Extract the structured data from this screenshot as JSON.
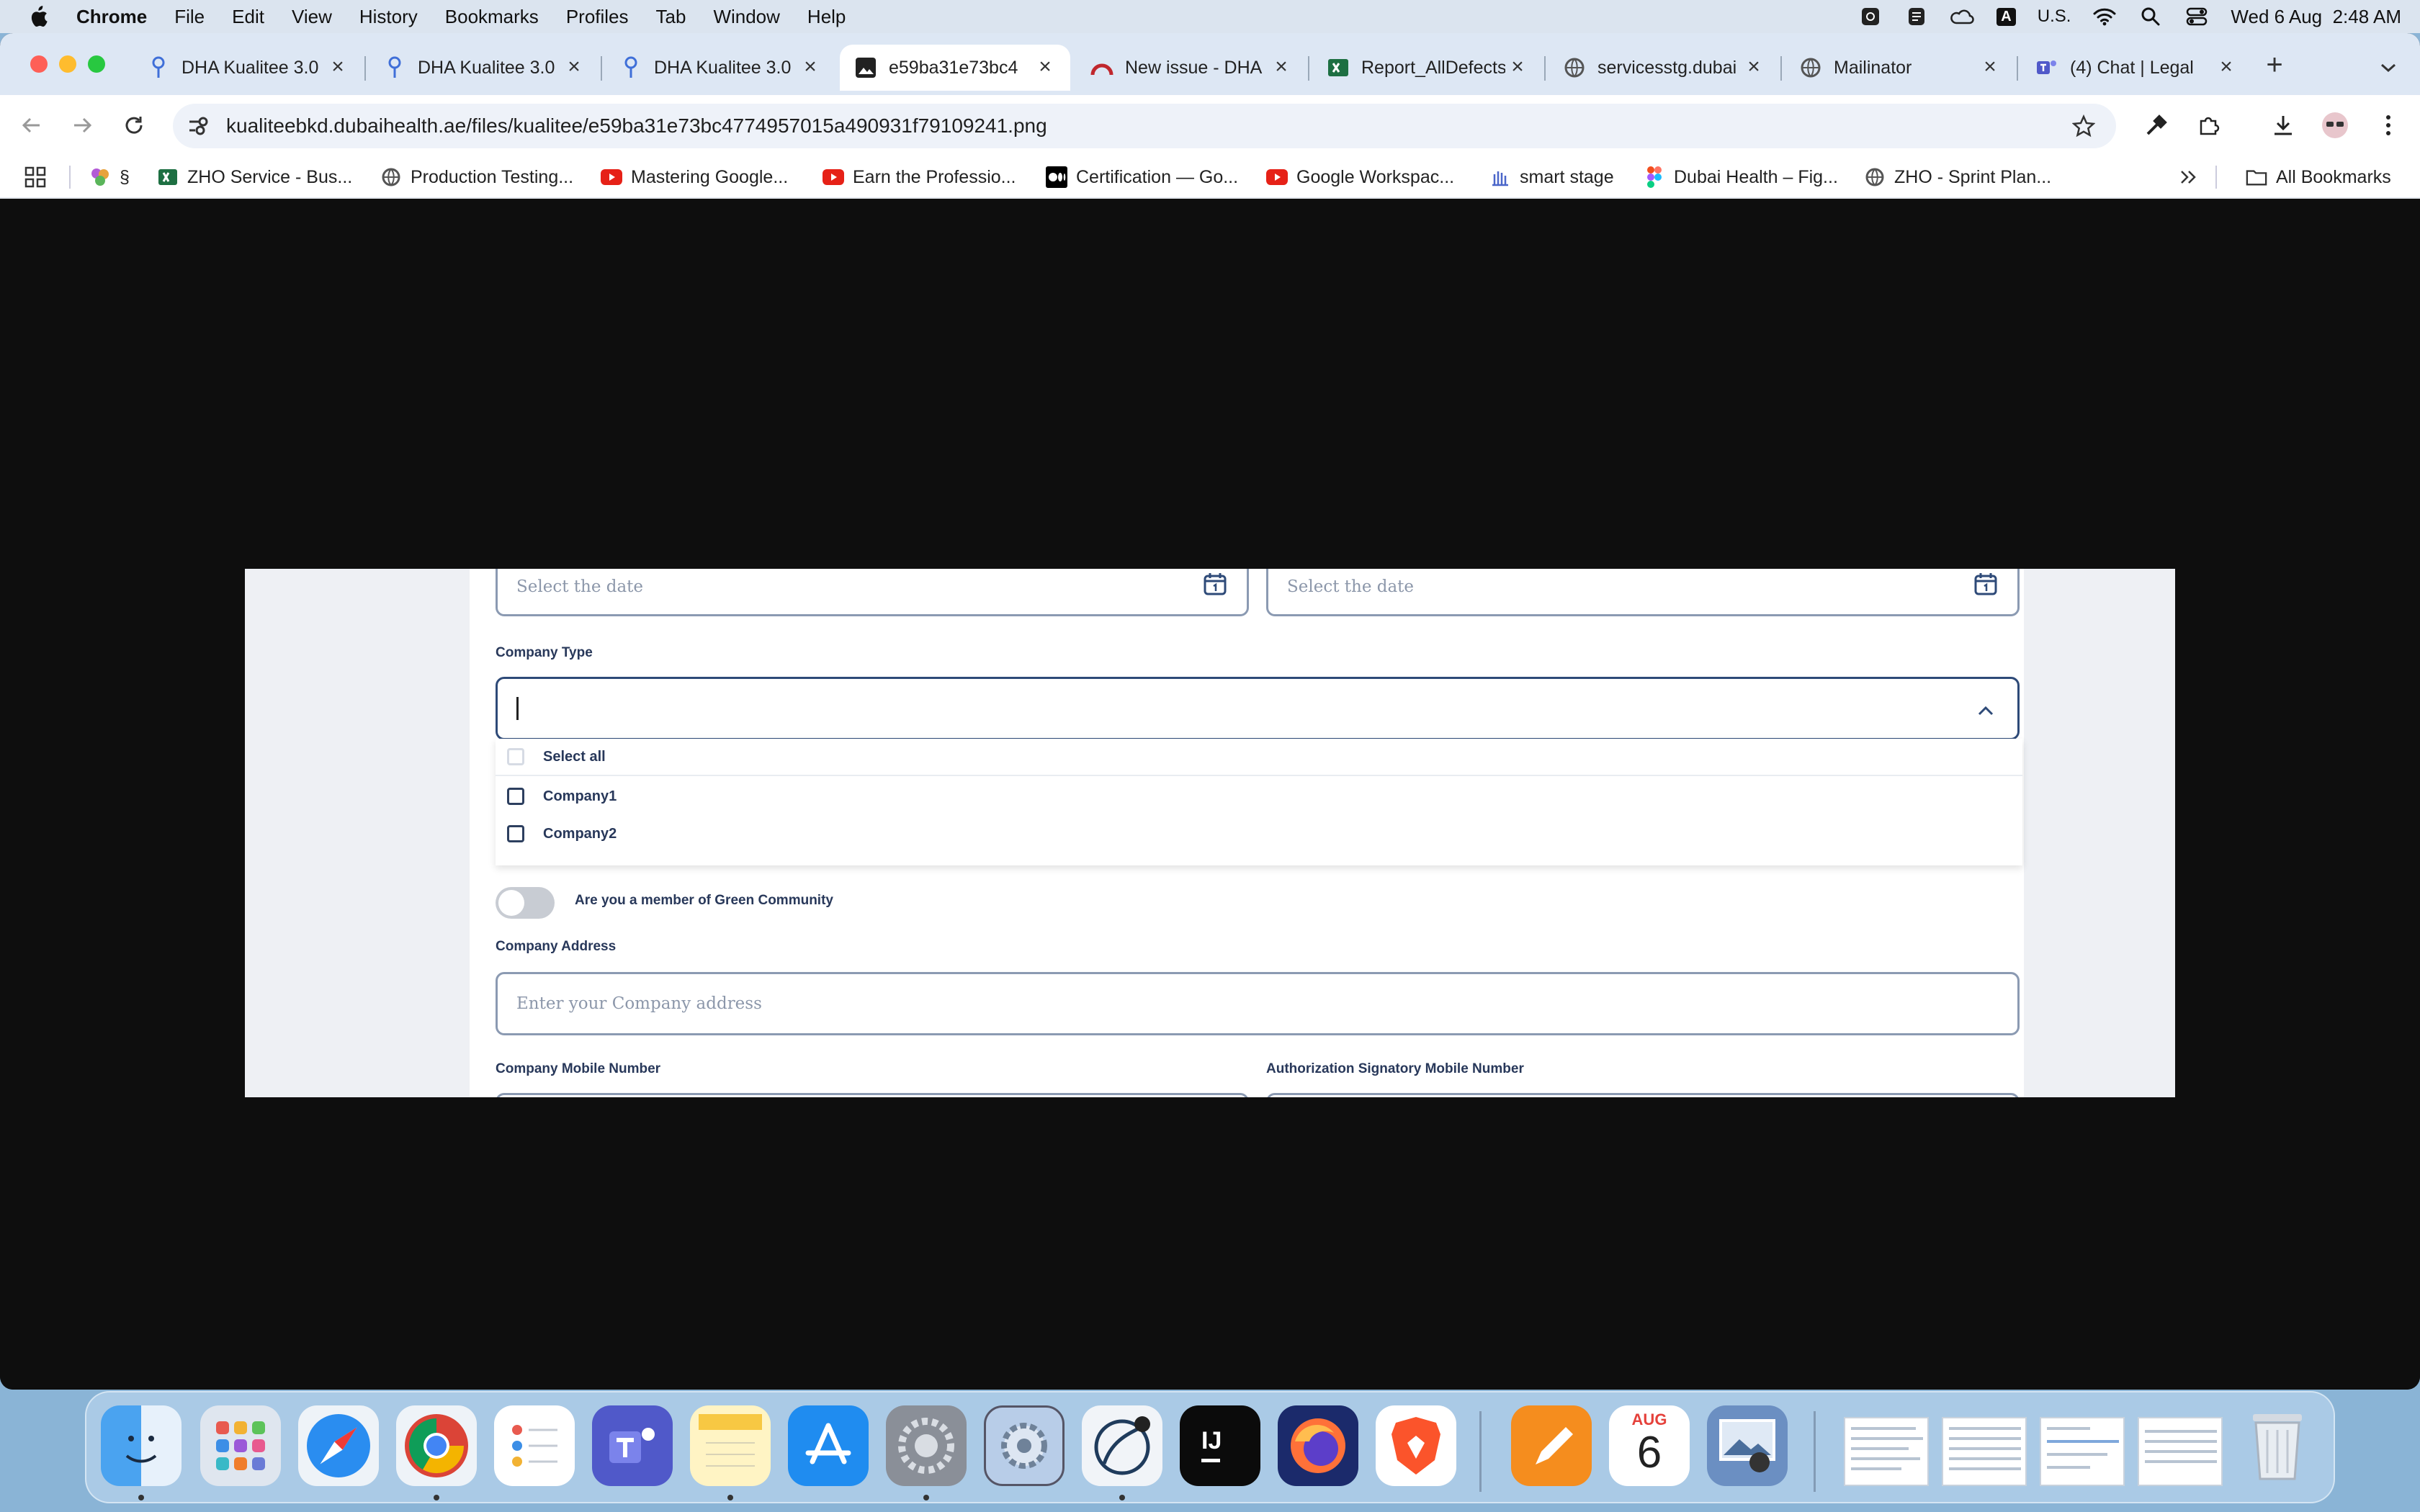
{
  "menubar": {
    "app": "Chrome",
    "items": [
      "File",
      "Edit",
      "View",
      "History",
      "Bookmarks",
      "Profiles",
      "Tab",
      "Window",
      "Help"
    ],
    "input_source": "A",
    "input_label": "U.S.",
    "datetime": "Wed 6 Aug  2:48 AM"
  },
  "tabs": [
    {
      "title": "DHA Kualitee 3.0",
      "icon": "kualitee-pin-icon",
      "active": false
    },
    {
      "title": "DHA Kualitee 3.0",
      "icon": "kualitee-pin-icon",
      "active": false
    },
    {
      "title": "DHA Kualitee 3.0",
      "icon": "kualitee-pin-icon",
      "active": false
    },
    {
      "title": "e59ba31e73bc4",
      "icon": "image-file-icon",
      "active": true
    },
    {
      "title": "New issue - DHA",
      "icon": "redmine-icon",
      "active": false
    },
    {
      "title": "Report_AllDefects",
      "icon": "excel-icon",
      "active": false
    },
    {
      "title": "servicesstg.dubai",
      "icon": "globe-icon",
      "active": false
    },
    {
      "title": "Mailinator",
      "icon": "globe-icon",
      "active": false
    },
    {
      "title": "(4) Chat | Legal",
      "icon": "teams-icon",
      "active": false
    }
  ],
  "address_bar": {
    "url": "kualiteebkd.dubaihealth.ae/files/kualitee/e59ba31e73bc4774957015a490931f79109241.png"
  },
  "bookmarks": [
    {
      "label": "§",
      "icon": "flower-icon"
    },
    {
      "label": "ZHO Service - Bus...",
      "icon": "excel-icon"
    },
    {
      "label": "Production Testing...",
      "icon": "globe-icon"
    },
    {
      "label": "Mastering Google...",
      "icon": "youtube-icon"
    },
    {
      "label": "Earn the Professio...",
      "icon": "youtube-icon"
    },
    {
      "label": "Certification — Go...",
      "icon": "medium-icon"
    },
    {
      "label": "Google Workspac...",
      "icon": "youtube-icon"
    },
    {
      "label": "smart stage",
      "icon": "building-icon"
    },
    {
      "label": "Dubai Health – Fig...",
      "icon": "figma-icon"
    },
    {
      "label": "ZHO - Sprint Plan...",
      "icon": "globe-icon"
    }
  ],
  "all_bookmarks_label": "All Bookmarks",
  "form": {
    "date_placeholder_1": "Select the date",
    "date_placeholder_2": "Select the date",
    "company_type_label": "Company Type",
    "dropdown_options": [
      "Select all",
      "Company1",
      "Company2"
    ],
    "green_toggle_label": "Are you a member of Green Community",
    "green_toggle_on": false,
    "company_address_label": "Company Address",
    "company_address_placeholder": "Enter your Company address",
    "company_mobile_label": "Company Mobile Number",
    "auth_mobile_label": "Authorization Signatory Mobile Number"
  },
  "dock": {
    "calendar_month": "AUG",
    "calendar_day": "6"
  },
  "colors": {
    "form_accent": "#2e4a78",
    "field_border": "#8b9ab2",
    "label_text": "#28385a"
  }
}
